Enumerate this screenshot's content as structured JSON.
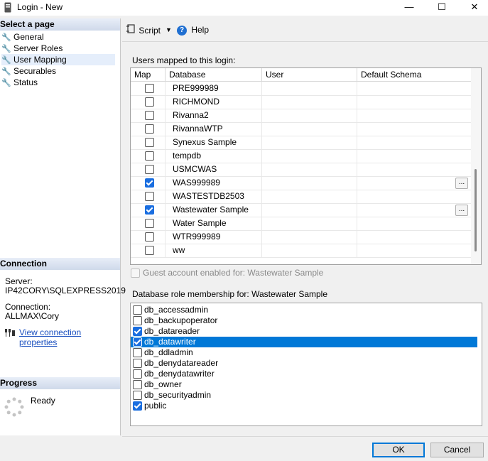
{
  "window": {
    "title": "Login - New"
  },
  "left_pane": {
    "select_page_header": "Select a page",
    "pages": [
      {
        "label": "General"
      },
      {
        "label": "Server Roles"
      },
      {
        "label": "User Mapping",
        "selected": true
      },
      {
        "label": "Securables"
      },
      {
        "label": "Status"
      }
    ],
    "connection": {
      "header": "Connection",
      "server_label": "Server:",
      "server_value": "IP42CORY\\SQLEXPRESS2019",
      "connection_label": "Connection:",
      "connection_value": "ALLMAX\\Cory",
      "view_props_link": "View connection properties"
    },
    "progress": {
      "header": "Progress",
      "status": "Ready"
    }
  },
  "toolbar": {
    "script_label": "Script",
    "help_label": "Help"
  },
  "users_mapped": {
    "label": "Users mapped to this login:",
    "columns": [
      "Map",
      "Database",
      "User",
      "Default Schema"
    ],
    "rows": [
      {
        "db": "PRE999989",
        "checked": false,
        "has_button": false
      },
      {
        "db": "RICHMOND",
        "checked": false,
        "has_button": false
      },
      {
        "db": "Rivanna2",
        "checked": false,
        "has_button": false
      },
      {
        "db": "RivannaWTP",
        "checked": false,
        "has_button": false
      },
      {
        "db": "Synexus Sample",
        "checked": false,
        "has_button": false
      },
      {
        "db": "tempdb",
        "checked": false,
        "has_button": false
      },
      {
        "db": "USMCWAS",
        "checked": false,
        "has_button": false
      },
      {
        "db": "WAS999989",
        "checked": true,
        "has_button": true
      },
      {
        "db": "WASTESTDB2503",
        "checked": false,
        "has_button": false
      },
      {
        "db": "Wastewater Sample",
        "checked": true,
        "has_button": true
      },
      {
        "db": "Water Sample",
        "checked": false,
        "has_button": false
      },
      {
        "db": "WTR999989",
        "checked": false,
        "has_button": false
      },
      {
        "db": "ww",
        "checked": false,
        "has_button": false
      }
    ],
    "ellipsis": "..."
  },
  "guest_account": {
    "label": "Guest account enabled for: Wastewater Sample",
    "checked": false
  },
  "roles": {
    "label": "Database role membership for: Wastewater Sample",
    "items": [
      {
        "name": "db_accessadmin",
        "checked": false,
        "selected": false
      },
      {
        "name": "db_backupoperator",
        "checked": false,
        "selected": false
      },
      {
        "name": "db_datareader",
        "checked": true,
        "selected": false
      },
      {
        "name": "db_datawriter",
        "checked": true,
        "selected": true
      },
      {
        "name": "db_ddladmin",
        "checked": false,
        "selected": false
      },
      {
        "name": "db_denydatareader",
        "checked": false,
        "selected": false
      },
      {
        "name": "db_denydatawriter",
        "checked": false,
        "selected": false
      },
      {
        "name": "db_owner",
        "checked": false,
        "selected": false
      },
      {
        "name": "db_securityadmin",
        "checked": false,
        "selected": false
      },
      {
        "name": "public",
        "checked": true,
        "selected": false
      }
    ]
  },
  "buttons": {
    "ok": "OK",
    "cancel": "Cancel"
  },
  "colors": {
    "accent": "#0078d7",
    "link": "#1a4fbf",
    "section_header": "#cfd9ea"
  }
}
